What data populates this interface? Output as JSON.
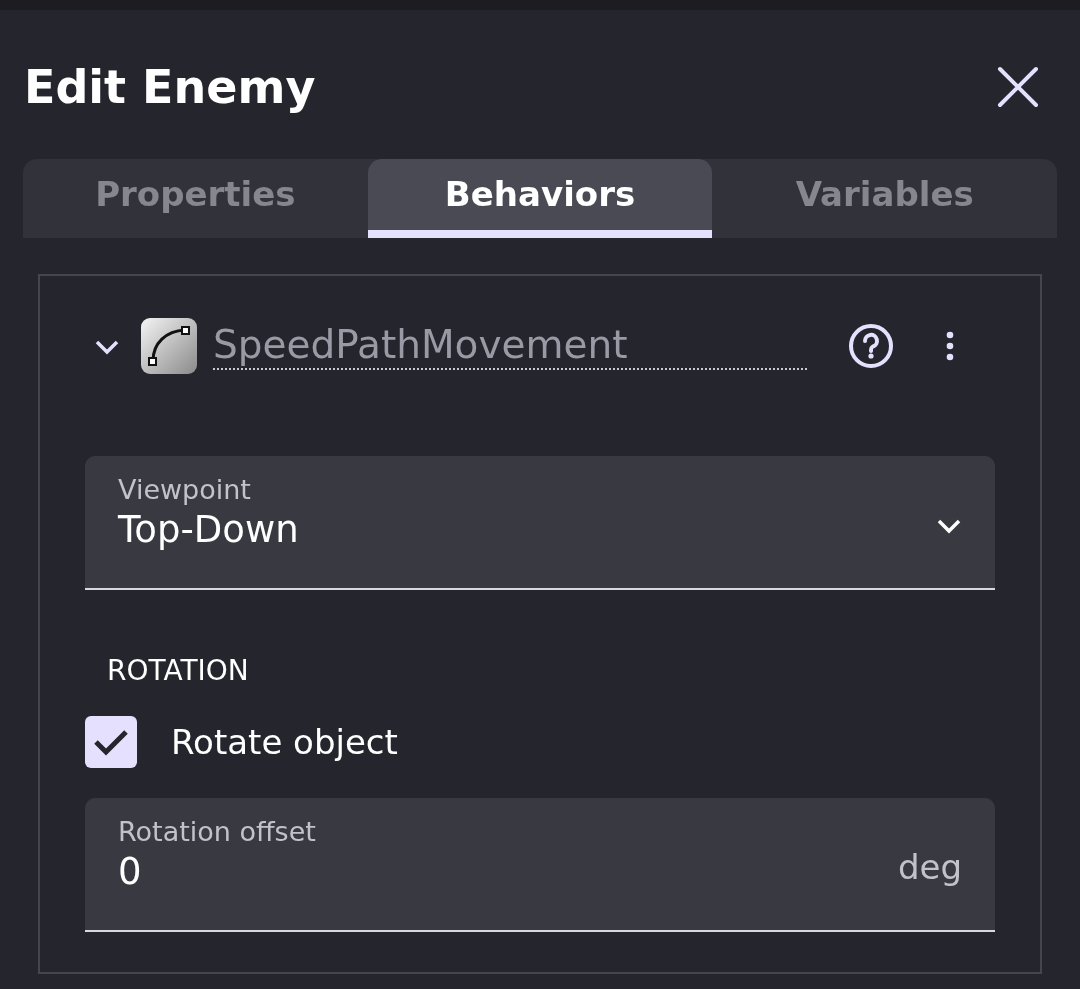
{
  "dialog": {
    "title": "Edit Enemy"
  },
  "tabs": [
    {
      "label": "Properties",
      "selected": false
    },
    {
      "label": "Behaviors",
      "selected": true
    },
    {
      "label": "Variables",
      "selected": false
    }
  ],
  "behavior": {
    "name": "SpeedPathMovement",
    "expanded": true
  },
  "viewpoint": {
    "label": "Viewpoint",
    "value": "Top-Down"
  },
  "section": "ROTATION",
  "rotate_object": {
    "label": "Rotate object",
    "checked": true
  },
  "rotation_offset": {
    "label": "Rotation offset",
    "value": "0",
    "unit": "deg"
  }
}
